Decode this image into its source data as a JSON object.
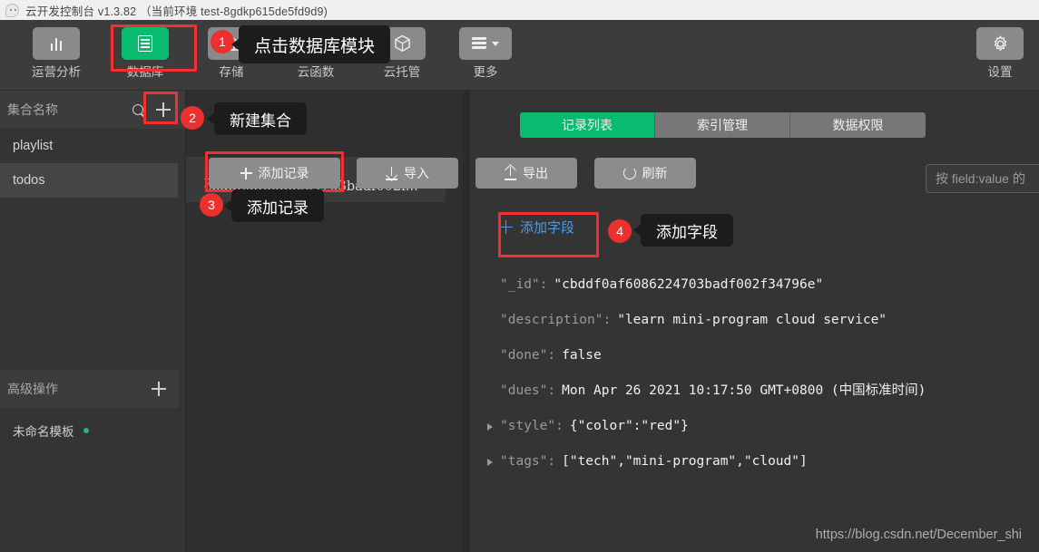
{
  "titlebar": {
    "logo_icon": "cloud-console-logo",
    "title": "云开发控制台 v1.3.82 （当前环境 test-8gdkp615de5fd9d9)"
  },
  "topnav": {
    "items": [
      {
        "label": "运营分析",
        "icon": "bar-chart-icon"
      },
      {
        "label": "数据库",
        "icon": "database-icon"
      },
      {
        "label": "存储",
        "icon": "storage-icon"
      },
      {
        "label": "云函数",
        "icon": "cloud-function-icon"
      },
      {
        "label": "云托管",
        "icon": "cube-icon"
      },
      {
        "label": "更多",
        "icon": "layers-icon"
      }
    ],
    "settings": {
      "label": "设置",
      "icon": "gear-icon"
    },
    "active_index": 1,
    "accent_color": "#09bb6f"
  },
  "sidebar": {
    "header": {
      "title": "集合名称",
      "search_icon": "search-icon",
      "add_icon": "plus-icon"
    },
    "collections": [
      {
        "name": "playlist",
        "selected": false
      },
      {
        "name": "todos",
        "selected": true
      }
    ],
    "advanced": {
      "title": "高级操作",
      "add_icon": "plus-icon"
    },
    "template": {
      "name": "未命名模板",
      "status_color": "#21ba72"
    }
  },
  "tabs": [
    {
      "label": "记录列表",
      "active": true
    },
    {
      "label": "索引管理",
      "active": false
    },
    {
      "label": "数据权限",
      "active": false
    }
  ],
  "toolbar": {
    "add_record": "添加记录",
    "import": "导入",
    "export": "导出",
    "refresh": "刷新"
  },
  "search": {
    "placeholder": "按 field:value 的"
  },
  "record_list": {
    "items": [
      {
        "label": "_id: cbddf0af6086224703badf002f..."
      }
    ]
  },
  "detail": {
    "add_field": "添加字段",
    "add_field_color": "#4c9ae8",
    "fields": [
      {
        "key": "\"_id\":",
        "value": "\"cbddf0af6086224703badf002f34796e\"",
        "expandable": false
      },
      {
        "key": "\"description\":",
        "value": "\"learn mini-program cloud service\"",
        "expandable": false
      },
      {
        "key": "\"done\":",
        "value": "false",
        "expandable": false
      },
      {
        "key": "\"dues\":",
        "value": "Mon Apr 26 2021 10:17:50 GMT+0800 (中国标准时间)",
        "expandable": false
      },
      {
        "key": "\"style\":",
        "value": "{\"color\":\"red\"}",
        "expandable": true
      },
      {
        "key": "\"tags\":",
        "value": "[\"tech\",\"mini-program\",\"cloud\"]",
        "expandable": true
      }
    ]
  },
  "annotations": [
    {
      "number": "1",
      "tooltip": "点击数据库模块"
    },
    {
      "number": "2",
      "tooltip": "新建集合"
    },
    {
      "number": "3",
      "tooltip": "添加记录"
    },
    {
      "number": "4",
      "tooltip": "添加字段"
    }
  ],
  "watermark": "https://blog.csdn.net/December_shi"
}
